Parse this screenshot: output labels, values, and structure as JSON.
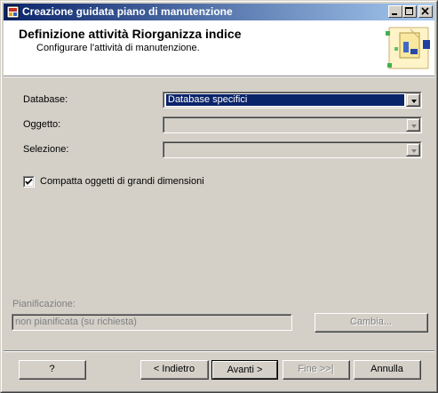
{
  "window": {
    "title": "Creazione guidata piano di manutenzione",
    "controls": [
      "minimize-icon",
      "maximize-icon",
      "close-icon"
    ]
  },
  "header": {
    "title": "Definizione attività Riorganizza indice",
    "subtitle": "Configurare l'attività di manutenzione."
  },
  "form": {
    "database": {
      "label": "Database:",
      "value": "Database specifici"
    },
    "oggetto": {
      "label": "Oggetto:",
      "value": ""
    },
    "selezione": {
      "label": "Selezione:",
      "value": ""
    },
    "compatta": {
      "label": "Compatta oggetti di grandi dimensioni",
      "checked": true
    }
  },
  "schedule": {
    "label": "Pianificazione:",
    "value": "non pianificata (su richiesta)",
    "change_button": "Cambia..."
  },
  "footer": {
    "help": "?",
    "back": "< Indietro",
    "next": "Avanti >",
    "finish": "Fine >>|",
    "cancel": "Annulla"
  },
  "colors": {
    "titlebar_start": "#0a246a",
    "titlebar_end": "#a6caf0",
    "selection": "#0a246a",
    "face": "#d4d0c8"
  }
}
